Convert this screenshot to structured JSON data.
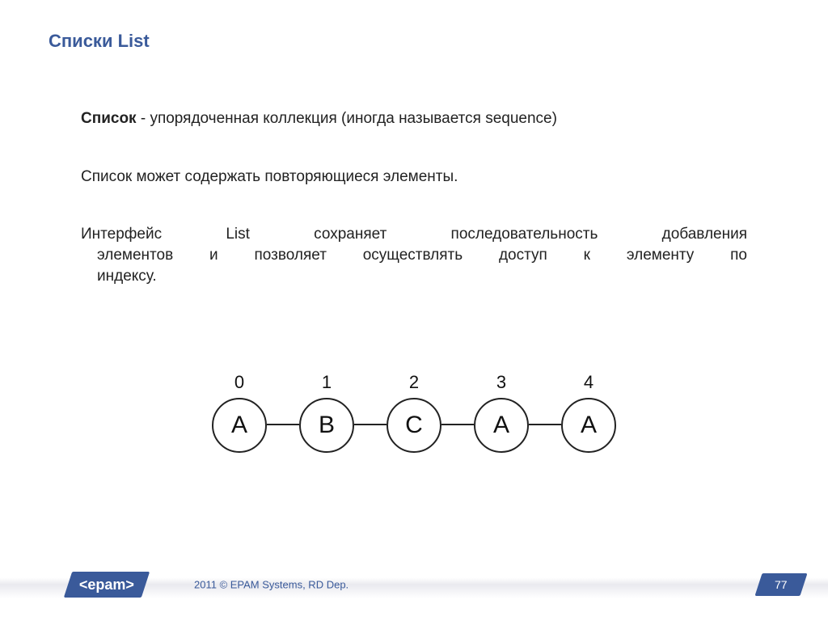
{
  "title": "Списки List",
  "para1_bold": "Список",
  "para1_rest": " - упорядоченная коллекция (иногда называется sequence)",
  "para2": "Список может содержать повторяющиеся элементы.",
  "para3_l1": "Интерфейс List сохраняет последовательность добавления",
  "para3_l2": "элементов и позволяет осуществлять доступ к элементу по",
  "para3_l3": "индексу.",
  "nodes": [
    {
      "index": "0",
      "label": "A"
    },
    {
      "index": "1",
      "label": "B"
    },
    {
      "index": "2",
      "label": "C"
    },
    {
      "index": "3",
      "label": "A"
    },
    {
      "index": "4",
      "label": "A"
    }
  ],
  "logo_text": "<epam>",
  "copyright": "2011 © EPAM Systems, RD Dep.",
  "page_number": "77"
}
